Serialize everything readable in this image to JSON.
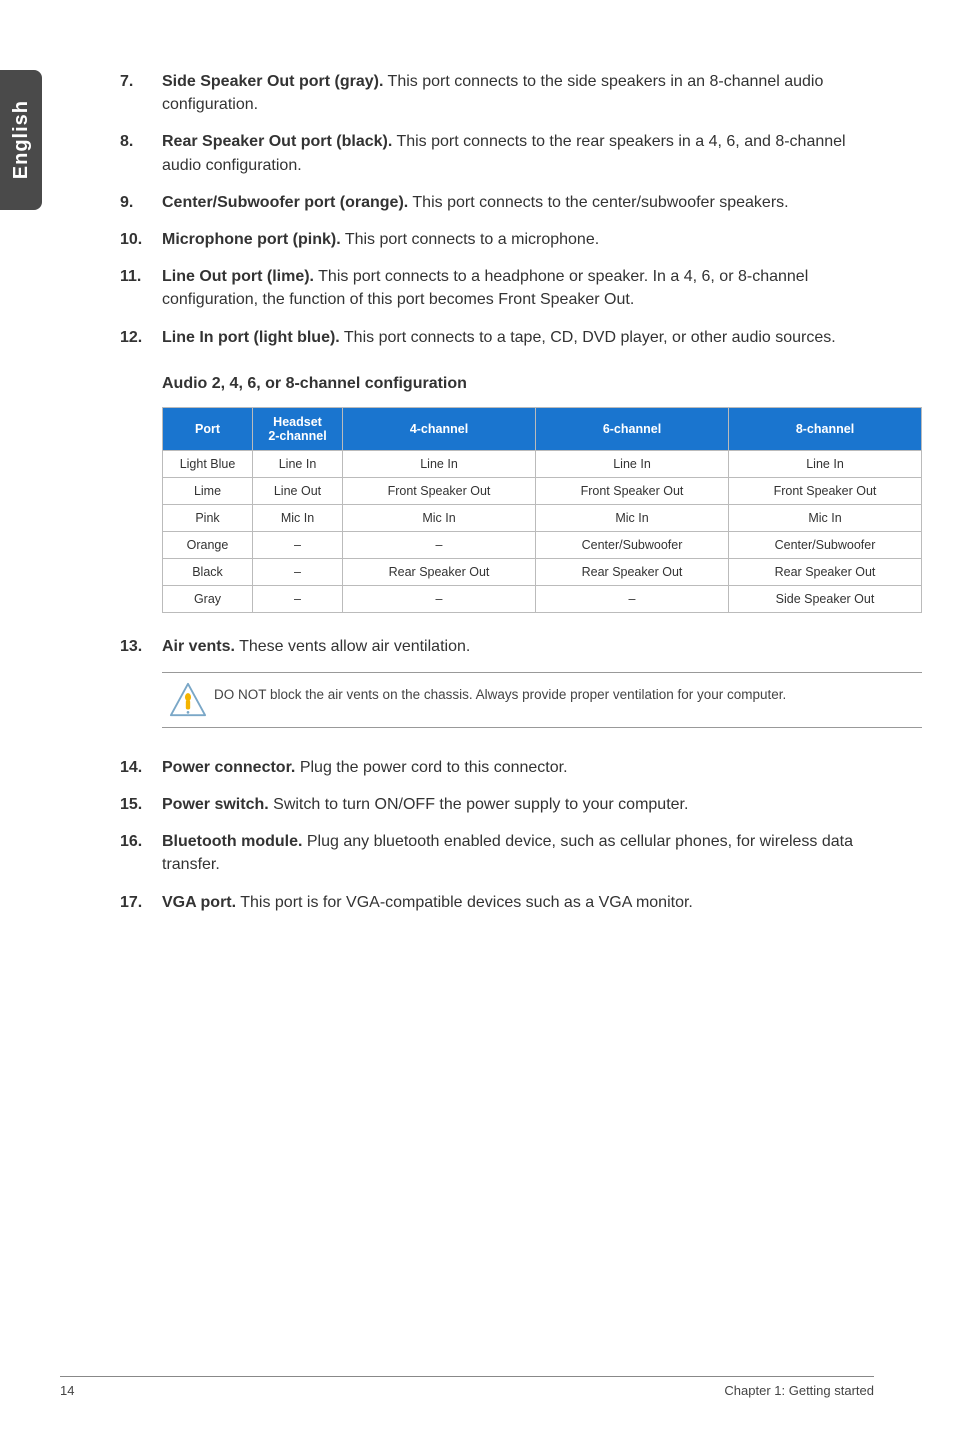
{
  "sideTab": "English",
  "items1": [
    {
      "num": "7.",
      "bold": "Side Speaker Out port (gray).",
      "text": " This port connects to the side speakers in an 8-channel audio configuration."
    },
    {
      "num": "8.",
      "bold": "Rear Speaker Out port (black).",
      "text": " This port connects to the rear speakers in a 4, 6, and 8-channel audio configuration."
    },
    {
      "num": "9.",
      "bold": "Center/Subwoofer port (orange).",
      "text": " This port connects to the center/subwoofer speakers."
    },
    {
      "num": "10.",
      "bold": "Microphone port (pink).",
      "text": " This port connects to a microphone."
    },
    {
      "num": "11.",
      "bold": "Line Out port (lime).",
      "text": " This port connects to a headphone or speaker. In a 4, 6, or 8-channel configuration, the function of this port becomes Front Speaker Out."
    },
    {
      "num": "12.",
      "bold": "Line In port (light blue).",
      "text": " This port connects to a tape, CD, DVD player, or other audio sources."
    }
  ],
  "audioHeading": "Audio 2, 4, 6, or 8-channel configuration",
  "table": {
    "headers": [
      "Port",
      "Headset 2-channel",
      "4-channel",
      "6-channel",
      "8-channel"
    ],
    "rows": [
      [
        "Light Blue",
        "Line In",
        "Line In",
        "Line In",
        "Line In"
      ],
      [
        "Lime",
        "Line Out",
        "Front Speaker Out",
        "Front Speaker Out",
        "Front Speaker Out"
      ],
      [
        "Pink",
        "Mic In",
        "Mic In",
        "Mic In",
        "Mic In"
      ],
      [
        "Orange",
        "–",
        "–",
        "Center/Subwoofer",
        "Center/Subwoofer"
      ],
      [
        "Black",
        "–",
        "Rear Speaker Out",
        "Rear Speaker Out",
        "Rear Speaker Out"
      ],
      [
        "Gray",
        "–",
        "–",
        "–",
        "Side Speaker Out"
      ]
    ]
  },
  "item13": {
    "num": "13.",
    "bold": "Air vents.",
    "text": " These vents allow air ventilation."
  },
  "noteText": "DO NOT block the air vents on the chassis. Always provide proper ventilation for your computer.",
  "items2": [
    {
      "num": "14.",
      "bold": "Power connector.",
      "text": " Plug the power cord to this connector."
    },
    {
      "num": "15.",
      "bold": "Power switch.",
      "text": " Switch to turn ON/OFF the power supply to your computer."
    },
    {
      "num": "16.",
      "bold": "Bluetooth module.",
      "text": " Plug any bluetooth enabled device, such as cellular phones, for wireless data transfer."
    },
    {
      "num": "17.",
      "bold": "VGA port.",
      "text": " This port is for VGA-compatible devices such as a VGA monitor."
    }
  ],
  "footer": {
    "page": "14",
    "chapter": "Chapter 1: Getting started"
  },
  "chart_data": {
    "type": "table",
    "title": "Audio 2, 4, 6, or 8-channel configuration",
    "columns": [
      "Port",
      "Headset 2-channel",
      "4-channel",
      "6-channel",
      "8-channel"
    ],
    "rows": [
      {
        "Port": "Light Blue",
        "Headset 2-channel": "Line In",
        "4-channel": "Line In",
        "6-channel": "Line In",
        "8-channel": "Line In"
      },
      {
        "Port": "Lime",
        "Headset 2-channel": "Line Out",
        "4-channel": "Front Speaker Out",
        "6-channel": "Front Speaker Out",
        "8-channel": "Front Speaker Out"
      },
      {
        "Port": "Pink",
        "Headset 2-channel": "Mic In",
        "4-channel": "Mic In",
        "6-channel": "Mic In",
        "8-channel": "Mic In"
      },
      {
        "Port": "Orange",
        "Headset 2-channel": null,
        "4-channel": null,
        "6-channel": "Center/Subwoofer",
        "8-channel": "Center/Subwoofer"
      },
      {
        "Port": "Black",
        "Headset 2-channel": null,
        "4-channel": "Rear Speaker Out",
        "6-channel": "Rear Speaker Out",
        "8-channel": "Rear Speaker Out"
      },
      {
        "Port": "Gray",
        "Headset 2-channel": null,
        "4-channel": null,
        "6-channel": null,
        "8-channel": "Side Speaker Out"
      }
    ]
  }
}
